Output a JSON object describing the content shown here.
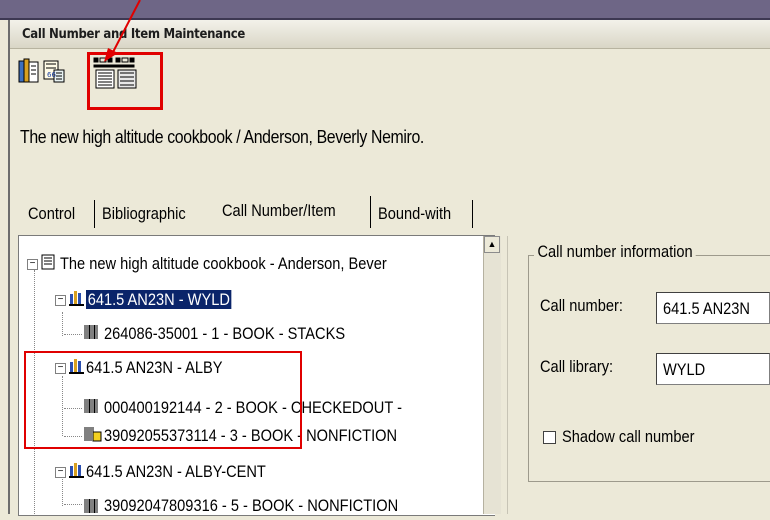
{
  "window": {
    "title": "Call Number and Item Maintenance"
  },
  "toolbar": {
    "buttons": [
      {
        "name": "title-record-icon"
      },
      {
        "name": "item-scan-icon"
      },
      {
        "name": "call-number-item-icon"
      }
    ]
  },
  "record": {
    "title": "The new high altitude cookbook / Anderson, Beverly Nemiro."
  },
  "tabs": [
    {
      "label": "Control"
    },
    {
      "label": "Bibliographic"
    },
    {
      "label": "Call Number/Item",
      "active": true
    },
    {
      "label": "Bound-with"
    }
  ],
  "tree": {
    "root": "The new high altitude cookbook - Anderson, Bever",
    "call_numbers": [
      {
        "label": "641.5 AN23N - WYLD",
        "selected": true,
        "items": [
          "264086-35001 - 1 - BOOK - STACKS"
        ]
      },
      {
        "label": "641.5 AN23N - ALBY",
        "items": [
          "000400192144 - 2 - BOOK - CHECKEDOUT -",
          "39092055373114 - 3 - BOOK - NONFICTION"
        ]
      },
      {
        "label": "641.5 AN23N - ALBY-CENT",
        "items": [
          "39092047809316 - 5 - BOOK - NONFICTION"
        ]
      }
    ]
  },
  "call_number_info": {
    "legend": "Call number information",
    "call_number_label": "Call number:",
    "call_number_value": "641.5 AN23N",
    "call_library_label": "Call library:",
    "call_library_value": "WYLD",
    "shadow_label": "Shadow call number",
    "shadow_checked": false
  },
  "colors": {
    "highlight": "#e00000",
    "selection": "#0a246a"
  }
}
